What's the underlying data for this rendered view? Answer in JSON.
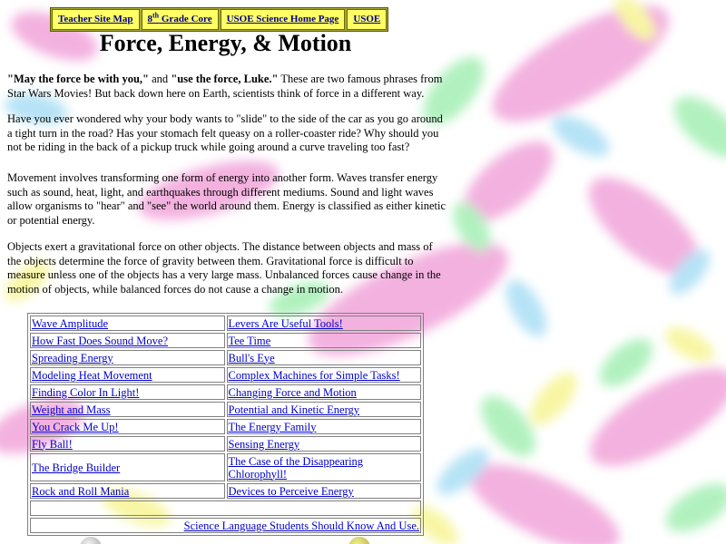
{
  "nav": [
    {
      "label": "Teacher Site Map"
    },
    {
      "label_pre": "8",
      "label_sup": "th",
      "label_post": " Grade Core"
    },
    {
      "label": "USOE Science Home Page"
    },
    {
      "label": "USOE"
    }
  ],
  "title": "Force, Energy, & Motion",
  "intro": {
    "quote1": "\"May the force be with you,\"",
    "and": " and ",
    "quote2": "\"use the force, Luke.\"",
    "rest": " These are two famous phrases from Star Wars Movies! But back down here on Earth, scientists think of force in a different way."
  },
  "paragraphs": [
    "Have you ever wondered why your body wants to \"slide\" to the side of the car as you go around a tight turn in the road? Has your stomach felt queasy on a roller-coaster ride? Why should you not be riding in the back of a pickup truck while going around a curve traveling too fast?",
    "Movement involves transforming one form of energy into another form. Waves transfer energy such as sound, heat, light, and earthquakes through different mediums. Sound and light waves allow organisms to \"hear\" and \"see\" the world around them. Energy is classified as either kinetic or potential energy.",
    "Objects exert a gravitational force on other objects. The distance between objects and mass of the objects determine the force of gravity between them. Gravitational force is difficult to measure unless one of the objects has a very large mass. Unbalanced forces cause change in the motion of objects, while balanced forces do not cause a change in motion."
  ],
  "links": [
    {
      "left": "Wave Amplitude",
      "right": "Levers Are Useful Tools!"
    },
    {
      "left": "How Fast Does Sound Move?",
      "right": "Tee Time"
    },
    {
      "left": "Spreading Energy",
      "right": "Bull's Eye"
    },
    {
      "left": "Modeling Heat Movement",
      "right": "Complex Machines for Simple Tasks!"
    },
    {
      "left": "Finding Color In Light!",
      "right": "Changing Force and Motion"
    },
    {
      "left": "Weight and Mass",
      "right": "Potential and Kinetic Energy"
    },
    {
      "left": "You Crack Me Up!",
      "right": "The Energy Family"
    },
    {
      "left": "Fly Ball!",
      "right": "Sensing Energy"
    },
    {
      "left": "The Bridge Builder",
      "right": "The Case of the Disappearing Chlorophyll!"
    },
    {
      "left": "Rock and Roll Mania",
      "right": "Devices to Perceive Energy"
    }
  ],
  "footer_link": "Science Language Students Should Know And Use.",
  "colors": {
    "nav_bg": "#ffff66",
    "link": "#0000cc",
    "blob_pink": "#f2a9dc",
    "blob_green": "#a9f0b8",
    "blob_blue": "#aee0f5",
    "blob_yellow": "#f7f59a"
  }
}
